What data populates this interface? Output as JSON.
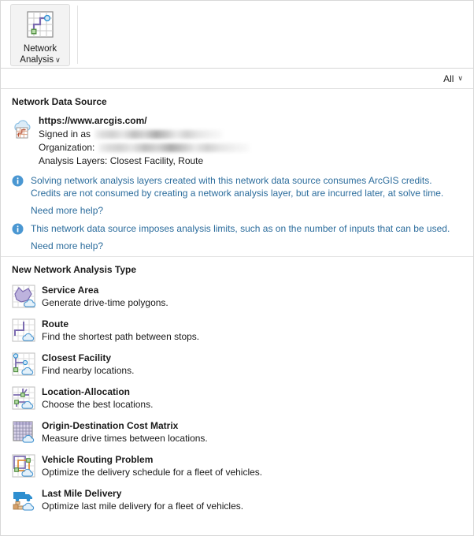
{
  "ribbon": {
    "button_label": "Network\nAnalysis",
    "button_icon": "network-analysis-icon",
    "dropdown_caret": "∨"
  },
  "filter_bar": {
    "label": "All",
    "caret": "∨"
  },
  "data_source_section": {
    "title": "Network Data Source",
    "icon": "cloud-network-dataset-icon",
    "url": "https://www.arcgis.com/",
    "signed_in_label": "Signed in as",
    "signed_in_value_redacted": true,
    "organization_label": "Organization:",
    "organization_value_redacted": true,
    "analysis_layers": "Analysis Layers: Closest Facility, Route",
    "notes": [
      {
        "icon": "info-icon",
        "text": "Solving network analysis layers created with this network data source consumes ArcGIS credits. Credits are not consumed by creating a network analysis layer, but are incurred later, at solve time.",
        "link": "Need more help?"
      },
      {
        "icon": "info-icon",
        "text": "This network data source imposes analysis limits, such as on the number of inputs that can be used.",
        "link": "Need more help?"
      }
    ]
  },
  "analysis_types_section": {
    "title": "New Network Analysis Type",
    "items": [
      {
        "icon": "service-area-icon",
        "name": "Service Area",
        "description": "Generate drive-time polygons."
      },
      {
        "icon": "route-icon",
        "name": "Route",
        "description": "Find the shortest path between stops."
      },
      {
        "icon": "closest-facility-icon",
        "name": "Closest Facility",
        "description": "Find nearby locations."
      },
      {
        "icon": "location-allocation-icon",
        "name": "Location-Allocation",
        "description": "Choose the best locations."
      },
      {
        "icon": "od-cost-matrix-icon",
        "name": "Origin-Destination Cost Matrix",
        "description": "Measure drive times between locations."
      },
      {
        "icon": "vehicle-routing-problem-icon",
        "name": "Vehicle Routing Problem",
        "description": "Optimize the delivery schedule for a fleet of vehicles."
      },
      {
        "icon": "last-mile-delivery-icon",
        "name": "Last Mile Delivery",
        "description": "Optimize last mile delivery for a fleet of vehicles."
      }
    ]
  },
  "colors": {
    "link": "#2b6c9c",
    "info_icon": "#4a97d2",
    "accent_purple": "#7b6bb0",
    "accent_green": "#5a9e4a",
    "accent_blue": "#2e8fd0",
    "panel_bg": "#ffffff",
    "ribbon_button_bg": "#f3f3f3"
  }
}
